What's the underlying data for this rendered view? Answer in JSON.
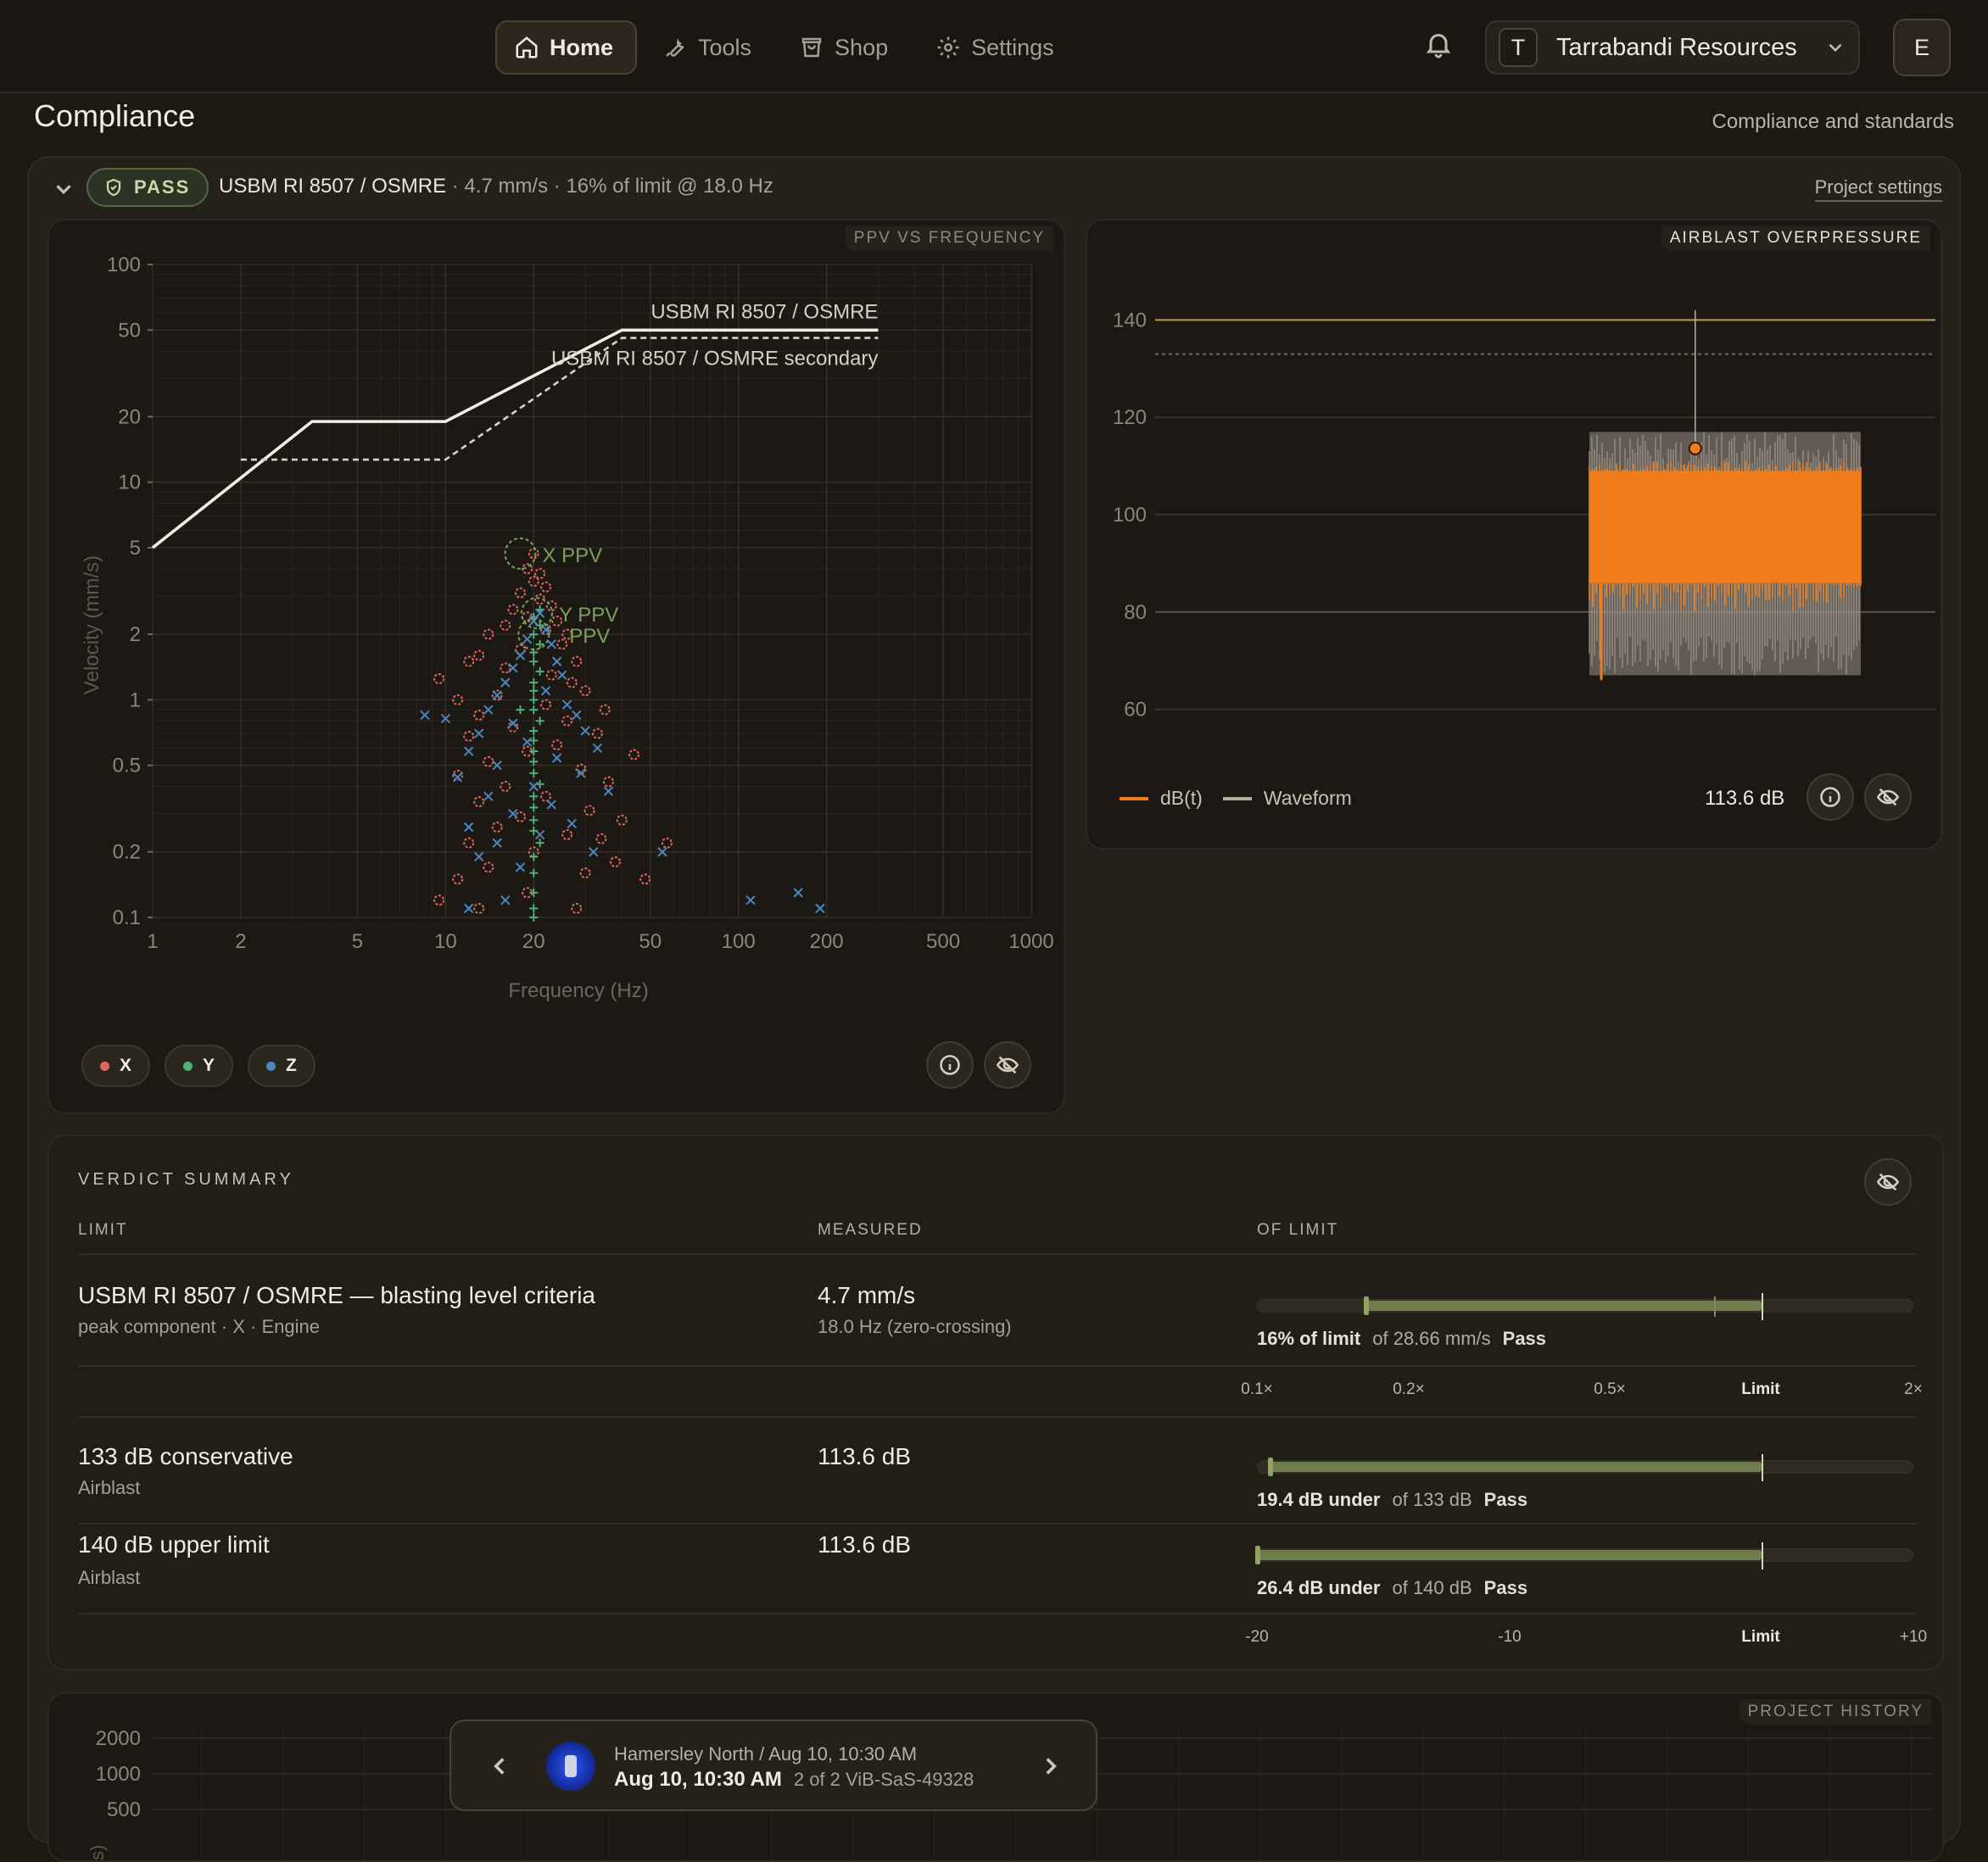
{
  "nav": {
    "items": [
      {
        "label": "Home",
        "icon": "home-icon",
        "active": true
      },
      {
        "label": "Tools",
        "icon": "wrench-icon",
        "active": false
      },
      {
        "label": "Shop",
        "icon": "shopping-bag-icon",
        "active": false
      },
      {
        "label": "Settings",
        "icon": "gear-icon",
        "active": false
      }
    ],
    "org_initial": "T",
    "org_name": "Tarrabandi Resources",
    "user_initial": "E"
  },
  "page": {
    "title": "Compliance",
    "subtitle": "Compliance and standards"
  },
  "summary": {
    "badge": "PASS",
    "standard": "USBM RI 8507 / OSMRE",
    "details": " · 4.7 mm/s · 16% of limit @ 18.0 Hz",
    "settings_link": "Project settings"
  },
  "ppv_chart": {
    "panel_label": "PPV VS FREQUENCY",
    "chart_data": {
      "type": "scatter",
      "x_scale": "log",
      "y_scale": "log",
      "xlabel": "Frequency (Hz)",
      "ylabel": "Velocity (mm/s)",
      "xlim": [
        1,
        1000
      ],
      "ylim": [
        0.1,
        100
      ],
      "x_ticks": [
        1,
        2,
        5,
        10,
        20,
        50,
        100,
        200,
        500,
        1000
      ],
      "y_ticks": [
        100,
        50,
        20,
        10,
        5,
        2,
        1,
        0.5,
        0.2,
        0.1
      ],
      "x_tick_labels": [
        "1",
        "2",
        "5",
        "10",
        "20",
        "50",
        "100",
        "200",
        "500",
        "1000"
      ],
      "y_tick_labels": [
        "100",
        "50",
        "20",
        "10",
        "5",
        "2",
        "1",
        "0.5",
        "0.2",
        "0.1"
      ],
      "grid": true,
      "limit_lines": [
        {
          "name": "USBM RI 8507 / OSMRE",
          "style": "solid",
          "color": "#f2ede2",
          "points": [
            [
              1,
              5
            ],
            [
              3.5,
              19
            ],
            [
              10,
              19
            ],
            [
              40,
              50
            ],
            [
              300,
              50
            ]
          ]
        },
        {
          "name": "USBM RI 8507 / OSMRE secondary",
          "style": "dashed",
          "color": "#d9d3c6",
          "points": [
            [
              2,
              12.7
            ],
            [
              10,
              12.7
            ],
            [
              40,
              46
            ],
            [
              300,
              46
            ]
          ]
        }
      ],
      "series": [
        {
          "name": "X",
          "color": "#e0675b",
          "marker": "circle",
          "points": [
            [
              20,
              4.7
            ],
            [
              19,
              4.0
            ],
            [
              21,
              3.8
            ],
            [
              20,
              3.5
            ],
            [
              22,
              3.3
            ],
            [
              18,
              3.1
            ],
            [
              21,
              2.9
            ],
            [
              23,
              2.7
            ],
            [
              17,
              2.6
            ],
            [
              19,
              2.4
            ],
            [
              24,
              2.3
            ],
            [
              16,
              2.2
            ],
            [
              22,
              2.1
            ],
            [
              26,
              2.0
            ],
            [
              14,
              2.0
            ],
            [
              25,
              1.8
            ],
            [
              18,
              1.7
            ],
            [
              13,
              1.6
            ],
            [
              28,
              1.5
            ],
            [
              12,
              1.5
            ],
            [
              16,
              1.4
            ],
            [
              23,
              1.3
            ],
            [
              9.5,
              1.25
            ],
            [
              27,
              1.2
            ],
            [
              30,
              1.1
            ],
            [
              15,
              1.05
            ],
            [
              11,
              1.0
            ],
            [
              22,
              0.95
            ],
            [
              35,
              0.9
            ],
            [
              13,
              0.85
            ],
            [
              26,
              0.8
            ],
            [
              17,
              0.75
            ],
            [
              33,
              0.7
            ],
            [
              12,
              0.68
            ],
            [
              24,
              0.62
            ],
            [
              19,
              0.58
            ],
            [
              44,
              0.56
            ],
            [
              14,
              0.52
            ],
            [
              29,
              0.48
            ],
            [
              11,
              0.45
            ],
            [
              36,
              0.42
            ],
            [
              16,
              0.4
            ],
            [
              22,
              0.36
            ],
            [
              13,
              0.34
            ],
            [
              31,
              0.31
            ],
            [
              18,
              0.29
            ],
            [
              40,
              0.28
            ],
            [
              15,
              0.26
            ],
            [
              26,
              0.24
            ],
            [
              12,
              0.22
            ],
            [
              34,
              0.23
            ],
            [
              20,
              0.2
            ],
            [
              38,
              0.18
            ],
            [
              14,
              0.17
            ],
            [
              57,
              0.22
            ],
            [
              11,
              0.15
            ],
            [
              48,
              0.15
            ],
            [
              30,
              0.16
            ],
            [
              19,
              0.13
            ],
            [
              9.5,
              0.12
            ],
            [
              13,
              0.11
            ],
            [
              28,
              0.11
            ]
          ]
        },
        {
          "name": "Y",
          "color": "#4fb07a",
          "marker": "plus",
          "points": [
            [
              21,
              2.6
            ],
            [
              20,
              2.4
            ],
            [
              21,
              2.2
            ],
            [
              20,
              2.0
            ],
            [
              21,
              1.8
            ],
            [
              20,
              1.65
            ],
            [
              20,
              1.5
            ],
            [
              21,
              1.35
            ],
            [
              20,
              1.2
            ],
            [
              20,
              1.1
            ],
            [
              20,
              1.0
            ],
            [
              20,
              0.9
            ],
            [
              21,
              0.8
            ],
            [
              20,
              0.72
            ],
            [
              20,
              0.65
            ],
            [
              20,
              0.58
            ],
            [
              20,
              0.52
            ],
            [
              20,
              0.46
            ],
            [
              21,
              0.41
            ],
            [
              20,
              0.36
            ],
            [
              20,
              0.32
            ],
            [
              20,
              0.28
            ],
            [
              20,
              0.25
            ],
            [
              21,
              0.22
            ],
            [
              20,
              0.19
            ],
            [
              20,
              0.16
            ],
            [
              20,
              0.13
            ],
            [
              20,
              0.11
            ],
            [
              20,
              0.1
            ],
            [
              18,
              0.9
            ]
          ]
        },
        {
          "name": "Z",
          "color": "#4c86c0",
          "marker": "x",
          "points": [
            [
              21,
              2.5
            ],
            [
              20,
              2.3
            ],
            [
              22,
              2.1
            ],
            [
              19,
              1.9
            ],
            [
              23,
              1.8
            ],
            [
              18,
              1.6
            ],
            [
              24,
              1.5
            ],
            [
              17,
              1.4
            ],
            [
              25,
              1.3
            ],
            [
              16,
              1.2
            ],
            [
              22,
              1.1
            ],
            [
              15,
              1.05
            ],
            [
              26,
              0.95
            ],
            [
              14,
              0.9
            ],
            [
              28,
              0.85
            ],
            [
              8.5,
              0.85
            ],
            [
              10,
              0.82
            ],
            [
              17,
              0.78
            ],
            [
              30,
              0.72
            ],
            [
              13,
              0.7
            ],
            [
              19,
              0.64
            ],
            [
              33,
              0.6
            ],
            [
              12,
              0.58
            ],
            [
              24,
              0.54
            ],
            [
              15,
              0.5
            ],
            [
              29,
              0.46
            ],
            [
              11,
              0.44
            ],
            [
              20,
              0.4
            ],
            [
              36,
              0.38
            ],
            [
              14,
              0.36
            ],
            [
              23,
              0.33
            ],
            [
              17,
              0.3
            ],
            [
              27,
              0.27
            ],
            [
              12,
              0.26
            ],
            [
              21,
              0.24
            ],
            [
              15,
              0.22
            ],
            [
              32,
              0.2
            ],
            [
              13,
              0.19
            ],
            [
              18,
              0.17
            ],
            [
              55,
              0.2
            ],
            [
              110,
              0.12
            ],
            [
              160,
              0.13
            ],
            [
              190,
              0.11
            ],
            [
              12,
              0.11
            ],
            [
              16,
              0.12
            ]
          ]
        }
      ],
      "annotations": [
        {
          "text": "X PPV",
          "x": 18,
          "y": 4.7,
          "color": "#7da05a"
        },
        {
          "text": "Y PPV",
          "x": 20.5,
          "y": 2.5,
          "color": "#7da05a"
        },
        {
          "text": "Z PPV",
          "x": 20,
          "y": 2.0,
          "color": "#7da05a",
          "visible_text": "PPV"
        }
      ]
    },
    "legend": [
      {
        "label": "X",
        "color": "#e0675b"
      },
      {
        "label": "Y",
        "color": "#4fb07a"
      },
      {
        "label": "Z",
        "color": "#4c86c0"
      }
    ]
  },
  "airblast_chart": {
    "panel_label": "AIRBLAST OVERPRESSURE",
    "chart_data": {
      "type": "line",
      "ylim": [
        50,
        150
      ],
      "y_ticks": [
        140,
        120,
        100,
        80,
        60
      ],
      "y_tick_labels": [
        "140",
        "120",
        "100",
        "80",
        "60"
      ],
      "grid": true,
      "reference_lines": [
        {
          "value": 140,
          "style": "solid",
          "color": "#b9995a"
        },
        {
          "value": 133,
          "style": "dashed",
          "color": "#6f6553"
        }
      ],
      "series": [
        {
          "name": "dB(t)",
          "color": "#f07c1a",
          "band_low": 86,
          "band_high": 109
        },
        {
          "name": "Waveform",
          "color": "#9c9488",
          "band_low": 67,
          "band_high": 117
        }
      ],
      "peak": {
        "value": 113.6,
        "time_fraction": 0.39
      },
      "x_extent_fraction": [
        0.0,
        1.0
      ]
    },
    "legend": [
      {
        "label": "dB(t)",
        "color": "#f07c1a"
      },
      {
        "label": "Waveform",
        "color": "#b5ada0"
      }
    ],
    "readout": "113.6 dB"
  },
  "verdict": {
    "title": "VERDICT SUMMARY",
    "columns": [
      "LIMIT",
      "MEASURED",
      "OF LIMIT"
    ],
    "rows": [
      {
        "name": "USBM RI 8507 / OSMRE — blasting level criteria",
        "sub": "peak component · X · Engine",
        "measured": "4.7 mm/s",
        "measured_sub": "18.0 Hz (zero-crossing)",
        "bar_emphasis": "16% of limit",
        "bar_of": "of 28.66 mm/s",
        "bar_status": "Pass",
        "ratio": 0.164
      },
      {
        "name": "133 dB conservative",
        "sub": "Airblast",
        "measured": "113.6 dB",
        "measured_sub": "",
        "bar_emphasis": "19.4 dB under",
        "bar_of": "of 133 dB",
        "bar_status": "Pass",
        "db_under": 19.4
      },
      {
        "name": "140 dB upper limit",
        "sub": "Airblast",
        "measured": "113.6 dB",
        "measured_sub": "",
        "bar_emphasis": "26.4 dB under",
        "bar_of": "of 140 dB",
        "bar_status": "Pass",
        "db_under": 26.4
      }
    ],
    "ratio_scale": [
      "0.1×",
      "0.2×",
      "0.5×",
      "Limit",
      "2×"
    ],
    "db_scale": [
      "-20",
      "-10",
      "Limit",
      "+10"
    ]
  },
  "history": {
    "panel_label": "PROJECT HISTORY",
    "y_tick_labels": [
      "2000",
      "1000",
      "500"
    ],
    "ylabel_fragment": "s)"
  },
  "pager": {
    "line1": "Hamersley North / Aug 10, 10:30 AM",
    "time": "Aug 10, 10:30 AM",
    "meta": "2 of 2  ViB-SaS-49328"
  }
}
